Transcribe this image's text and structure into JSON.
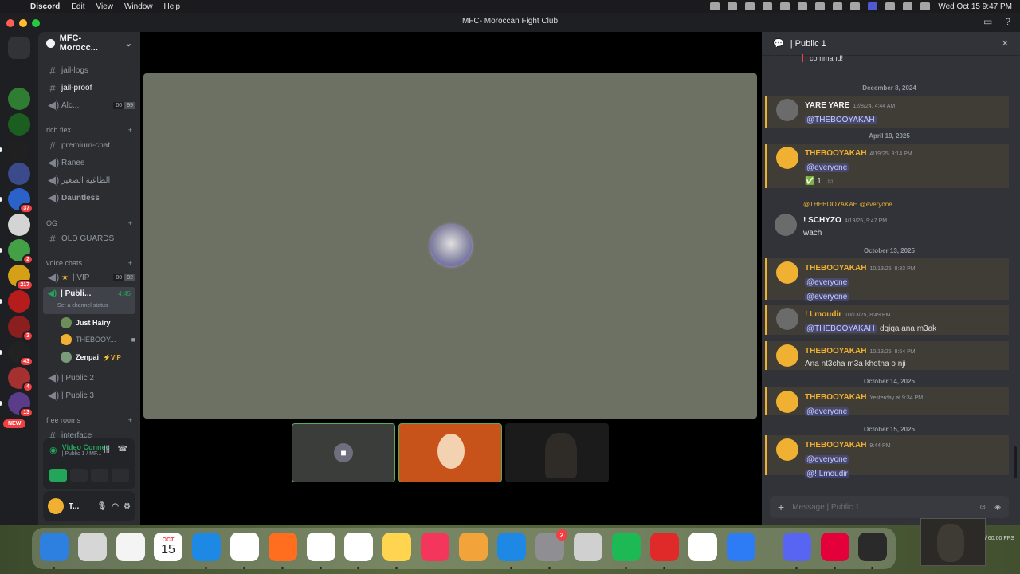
{
  "menubar": {
    "app": "Discord",
    "items": [
      "Edit",
      "View",
      "Window",
      "Help"
    ],
    "clock": "Wed Oct 15  9:47 PM"
  },
  "window": {
    "title": "MFC- Moroccan Fight Club"
  },
  "servers": [
    {
      "icon": "discord-home-icon",
      "color": "#313338"
    },
    {
      "icon": "wolf-server-icon",
      "color": "#1e1f22"
    },
    {
      "icon": "green-server-icon",
      "color": "#2e7d32"
    },
    {
      "icon": "server-icon",
      "color": "#1b5e20"
    },
    {
      "icon": "mfc-server-icon",
      "color": "#202020"
    },
    {
      "icon": "server-icon",
      "color": "#3a4a8a"
    },
    {
      "icon": "server-icon",
      "color": "#2a62c9",
      "badge": "37"
    },
    {
      "icon": "server-icon",
      "color": "#d4d4d4"
    },
    {
      "icon": "server-icon",
      "color": "#43a047",
      "badge": "2"
    },
    {
      "icon": "server-icon",
      "color": "#d4a017",
      "badge": "217"
    },
    {
      "icon": "server-icon",
      "color": "#b71c1c"
    },
    {
      "icon": "server-icon",
      "color": "#8b1f1f",
      "badge": "3"
    },
    {
      "icon": "server-icon",
      "color": "#222222",
      "badge": "43"
    },
    {
      "icon": "server-icon",
      "color": "#a53030",
      "badge": "4"
    },
    {
      "icon": "server-icon",
      "color": "#5a3c8a",
      "badge": "13"
    }
  ],
  "new_badge": "NEW",
  "guild": {
    "name": "MFC- Moroccan Fight Club",
    "short": "MFC- Morocc..."
  },
  "channels": {
    "jail_logs": "jail-logs",
    "jail_proof": "jail-proof",
    "alc": "Alc...",
    "alc_counts": [
      "00",
      "99"
    ],
    "cat_rich": "rich flex",
    "premium": "premium-chat",
    "ranee": "Ranee",
    "arabic": "الطاغية الصغير",
    "dauntless": "Dauntless",
    "cat_og": "OG",
    "old_guards": "OLD GUARDS",
    "cat_voice": "voice chats",
    "vip": "| VIP",
    "vip_counts": [
      "00",
      "02"
    ],
    "public1": "| Publi...",
    "public1_time": "4:45",
    "status": "Set a channel status",
    "public2": "| Public 2",
    "public3": "| Public 3",
    "cat_free": "free rooms",
    "interface": "interface"
  },
  "voice_users": [
    {
      "name": "Just Hairy",
      "color": "#6b8e5a"
    },
    {
      "name": "THEBOOY...",
      "color": "#f0b132"
    },
    {
      "name": "Zenpai",
      "color": "#7a9a7a",
      "tag": "⚡VIP"
    }
  ],
  "voice_panel": {
    "status": "Video Connected",
    "sub": "| Public 1 / MF..."
  },
  "user_panel": {
    "name": "T...",
    "sub": ""
  },
  "chat": {
    "channel": "| Public 1",
    "top_snippet": "command!",
    "placeholder": "Message | Public 1",
    "dates": [
      "December 8, 2024",
      "April 19, 2025",
      "October 13, 2025",
      "October 14, 2025",
      "October 15, 2025"
    ],
    "messages": [
      {
        "author": "YARE YARE",
        "time": "12/8/24, 4:44 AM",
        "mention": "@THEBOOYAKAH",
        "text": "",
        "white": true
      },
      {
        "author": "THEBOOYAKAH",
        "time": "4/19/25, 8:14 PM",
        "mention": "@everyone",
        "reaction": "✅ 1"
      },
      {
        "author": "! SCHYZO",
        "time": "4/19/25, 9:47 PM",
        "reply": "@THEBOOYAKAH @everyone",
        "text": "wach",
        "white": true
      },
      {
        "author": "THEBOOYAKAH",
        "time": "10/13/25, 8:33 PM",
        "mention": "@everyone",
        "mention2": "@everyone"
      },
      {
        "author": "! Lmoudir",
        "time": "10/13/25, 8:49 PM",
        "mention": "@THEBOOYAKAH",
        "text": "dqiqa ana m3ak"
      },
      {
        "author": "THEBOOYAKAH",
        "time": "10/13/25, 8:54 PM",
        "text": "Ana nt3cha m3a khotna o nji"
      },
      {
        "author": "THEBOOYAKAH",
        "time": "Yesterday at 9:34 PM",
        "mention": "@everyone"
      },
      {
        "author": "THEBOOYAKAH",
        "time": "9:44 PM",
        "mention": "@everyone",
        "mention2": "@! Lmoudir"
      }
    ]
  },
  "dock": {
    "calendar_month": "OCT",
    "calendar_day": "15",
    "settings_badge": "2",
    "apps": [
      {
        "name": "finder-icon",
        "color": "#2d7fe0"
      },
      {
        "name": "launchpad-icon",
        "color": "#d6d6d6"
      },
      {
        "name": "photos-icon",
        "color": "#f4f4f4"
      },
      {
        "name": "calendar-icon",
        "color": "#ffffff"
      },
      {
        "name": "safari-icon",
        "color": "#1e88e5"
      },
      {
        "name": "chrome-icon",
        "color": "#ffffff"
      },
      {
        "name": "firefox-icon",
        "color": "#ff6d1f"
      },
      {
        "name": "opera-icon",
        "color": "#ffffff"
      },
      {
        "name": "reminders-icon",
        "color": "#ffffff"
      },
      {
        "name": "notes-icon",
        "color": "#ffd54f"
      },
      {
        "name": "music-icon",
        "color": "#f5365c"
      },
      {
        "name": "pages-icon",
        "color": "#f2a33a"
      },
      {
        "name": "appstore-icon",
        "color": "#1e88e5"
      },
      {
        "name": "system-settings-icon",
        "color": "#8e8e93"
      },
      {
        "name": "iphone-mirroring-icon",
        "color": "#d0d0d0"
      },
      {
        "name": "spotify-icon",
        "color": "#1db954"
      },
      {
        "name": "creative-cloud-icon",
        "color": "#e02a2a"
      },
      {
        "name": "proton-vpn-icon",
        "color": "#ffffff"
      },
      {
        "name": "roblox-icon",
        "color": "#2e7bf6"
      },
      {
        "name": "discord-icon",
        "color": "#5865f2"
      },
      {
        "name": "parsec-icon",
        "color": "#e4003b"
      },
      {
        "name": "obs-icon",
        "color": "#2a2a2a"
      }
    ]
  },
  "cam_overlay": {
    "fps": "/ 60.00 FPS"
  }
}
